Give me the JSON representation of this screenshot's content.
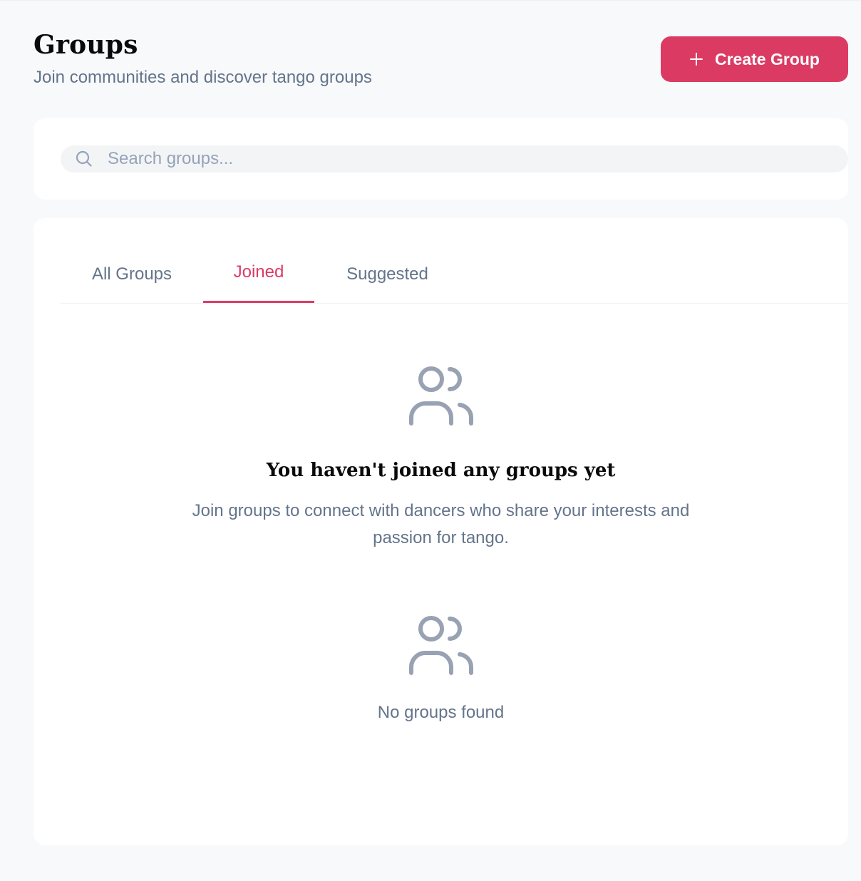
{
  "header": {
    "title": "Groups",
    "subtitle": "Join communities and discover tango groups",
    "create_button_label": "Create Group"
  },
  "search": {
    "placeholder": "Search groups...",
    "value": ""
  },
  "tabs": [
    {
      "label": "All Groups",
      "active": false
    },
    {
      "label": "Joined",
      "active": true
    },
    {
      "label": "Suggested",
      "active": false
    }
  ],
  "empty_state": {
    "icon": "users-icon",
    "title": "You haven't joined any groups yet",
    "description": "Join groups to connect with dancers who share your interests and passion for tango."
  },
  "no_results": {
    "icon": "users-icon",
    "text": "No groups found"
  },
  "colors": {
    "accent": "#db3b63",
    "background": "#f8f9fb",
    "card": "#ffffff",
    "muted_text": "#64748b",
    "icon_gray": "#98a2b3"
  }
}
